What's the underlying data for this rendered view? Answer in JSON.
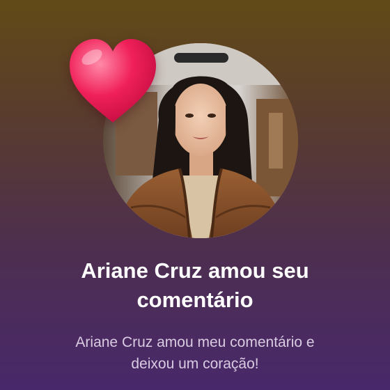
{
  "notification": {
    "title_line1": "Ariane Cruz amou seu",
    "title_line2": "comentário",
    "message_line1": "Ariane Cruz amou meu comentário e",
    "message_line2": "deixou um coração!"
  },
  "avatar": {
    "icon": "profile-photo"
  },
  "reaction": {
    "icon": "heart-icon",
    "color": "#f0205a"
  },
  "colors": {
    "background_top": "#624a17",
    "background_bottom": "#48286a",
    "title_text": "#ffffff",
    "message_text": "#d9cce2"
  }
}
